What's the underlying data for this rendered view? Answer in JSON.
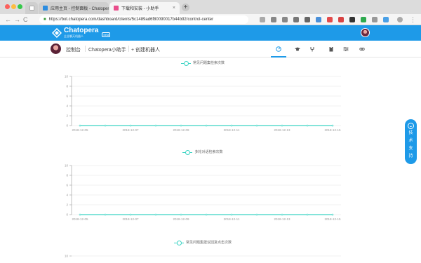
{
  "browser": {
    "tabs": [
      {
        "title": "应用主页 - 控制面板 - Chatopera",
        "favicon_color": "#2b8ce0",
        "active": false
      },
      {
        "title": "下载和安装 - 小助手",
        "favicon_color": "#e94d8b",
        "active": true
      }
    ],
    "new_tab_label": "+",
    "url": "https://bot.chatopera.com/dashboard/clients/5c1489ad6f80090017b44b92/control-center",
    "back_icon": "←",
    "forward_icon": "→",
    "reload_icon": "C"
  },
  "app": {
    "logo_text": "Chatopera",
    "logo_subtext": "企业聊天机器人",
    "logo_badge": "beta",
    "brand_color": "#1e9ae8"
  },
  "breadcrumb": {
    "home": "控制台",
    "bot": "Chatopera小助手",
    "create": "+ 创建机器人"
  },
  "nav_icons": [
    "dashboard-icon",
    "graduation-cap-icon",
    "fork-icon",
    "clipboard-icon",
    "sliders-icon",
    "link-icon"
  ],
  "charts": [
    {
      "legend": "常见问题集检索次数",
      "chart_data": {
        "type": "line",
        "x": [
          "2018-12-05",
          "2018-12-06",
          "2018-12-07",
          "2018-12-08",
          "2018-12-09",
          "2018-12-10",
          "2018-12-11",
          "2018-12-12",
          "2018-12-13",
          "2018-12-14",
          "2018-12-15"
        ],
        "x_tick_labels": [
          "2018-12-05",
          "2018-12-07",
          "2018-12-09",
          "2018-12-11",
          "2018-12-13",
          "2018-12-15"
        ],
        "series": [
          {
            "name": "常见问题集检索次数",
            "values": [
              0,
              0,
              0,
              0,
              0,
              0,
              0,
              0,
              0,
              0,
              0
            ]
          }
        ],
        "y_tick_labels": [
          "10",
          "8",
          "6",
          "4",
          "2",
          "0"
        ],
        "ylim": [
          0,
          10
        ],
        "grid": true,
        "legend_position": "top-center"
      }
    },
    {
      "legend": "多轮对话检索次数",
      "chart_data": {
        "type": "line",
        "x": [
          "2018-12-05",
          "2018-12-06",
          "2018-12-07",
          "2018-12-08",
          "2018-12-09",
          "2018-12-10",
          "2018-12-11",
          "2018-12-12",
          "2018-12-13",
          "2018-12-14",
          "2018-12-15"
        ],
        "x_tick_labels": [
          "2018-12-05",
          "2018-12-07",
          "2018-12-09",
          "2018-12-11",
          "2018-12-13",
          "2018-12-15"
        ],
        "series": [
          {
            "name": "多轮对话检索次数",
            "values": [
              0,
              0,
              0,
              0,
              0,
              0,
              0,
              0,
              0,
              0,
              0
            ]
          }
        ],
        "y_tick_labels": [
          "10",
          "8",
          "6",
          "4",
          "2",
          "0"
        ],
        "ylim": [
          0,
          10
        ],
        "grid": true,
        "legend_position": "top-center"
      }
    },
    {
      "legend": "常见问题集建议回复点击次数",
      "chart_data": {
        "type": "line",
        "x": [],
        "x_tick_labels": [],
        "series": [
          {
            "name": "常见问题集建议回复点击次数",
            "values": []
          }
        ],
        "y_tick_labels": [
          "10"
        ],
        "ylim": [
          0,
          10
        ],
        "grid": true,
        "legend_position": "top-center"
      }
    }
  ],
  "support_widget": {
    "chars": [
      "技",
      "术",
      "支",
      "持"
    ]
  },
  "colors": {
    "series_line": "#3ad3c3",
    "grid": "#e6e6e6"
  }
}
